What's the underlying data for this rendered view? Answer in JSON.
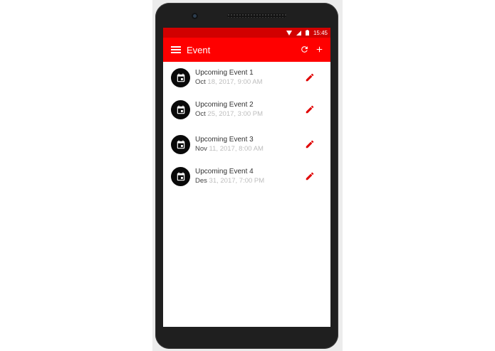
{
  "status_bar": {
    "time": "15:45",
    "icons": [
      "wifi-icon",
      "signal-icon",
      "battery-icon"
    ],
    "color": "#d10000"
  },
  "app_bar": {
    "title": "Event",
    "color": "#ff0000",
    "actions": [
      "refresh-icon",
      "add-icon"
    ]
  },
  "events": [
    {
      "title": "Upcoming Event 1",
      "month": "Oct",
      "rest": "18, 2017, 9:00 AM"
    },
    {
      "title": "Upcoming Event 2",
      "month": "Oct",
      "rest": "25, 2017, 3:00 PM"
    },
    {
      "title": "Upcoming Event 3",
      "month": "Nov",
      "rest": "11, 2017, 8:00 AM"
    },
    {
      "title": "Upcoming Event 4",
      "month": "Des",
      "rest": "31, 2017, 7:00 PM"
    }
  ],
  "accent_color": "#e00000"
}
